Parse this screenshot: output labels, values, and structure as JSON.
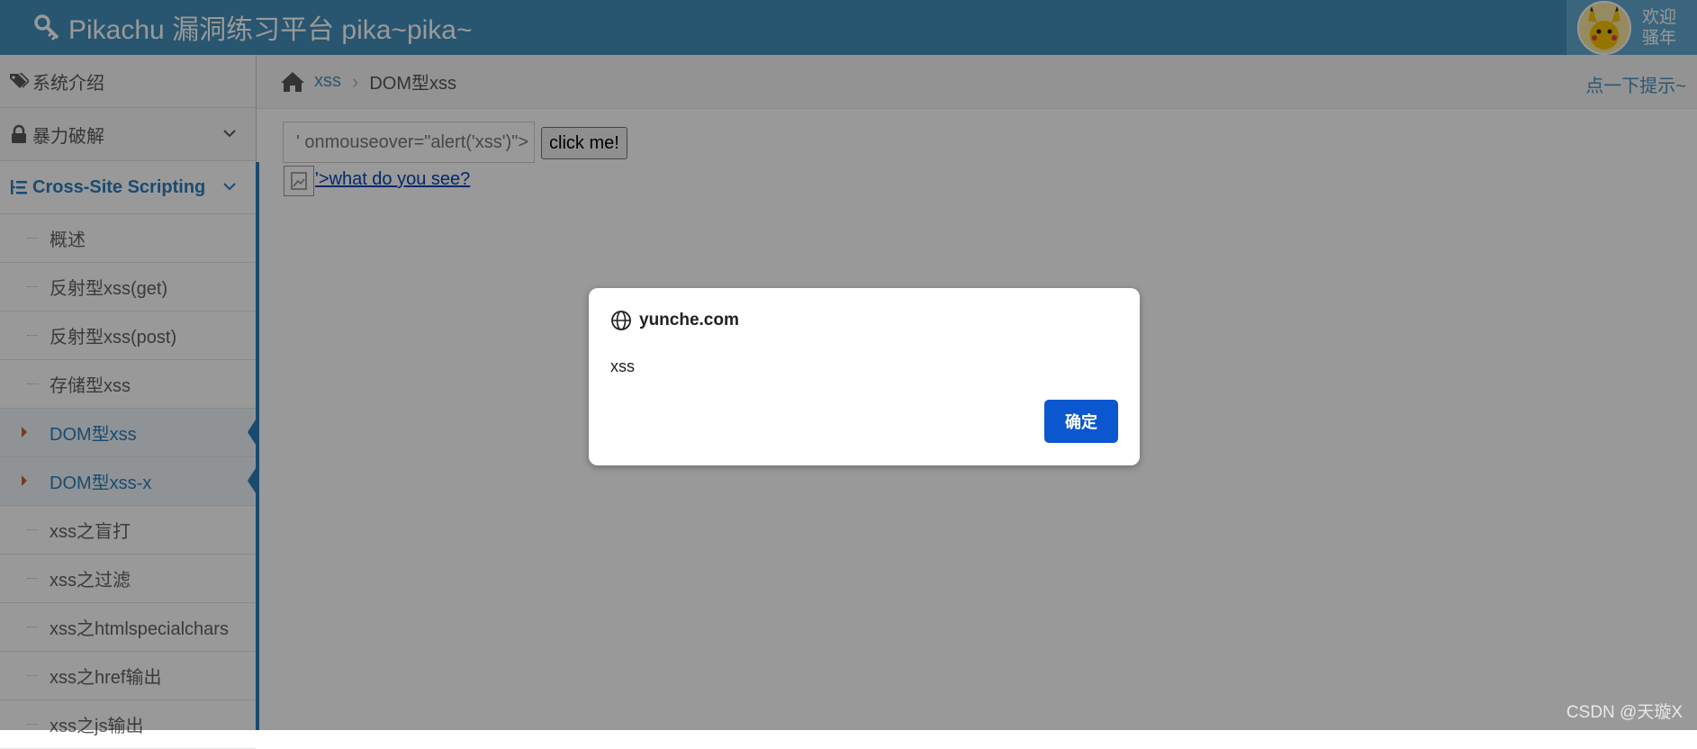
{
  "header": {
    "title": "Pikachu 漏洞练习平台 pika~pika~",
    "welcome_line1": "欢迎",
    "welcome_line2": "骚年"
  },
  "sidebar": {
    "items": [
      {
        "label": "系统介绍",
        "icon": "tags-icon"
      },
      {
        "label": "暴力破解",
        "icon": "lock-icon"
      },
      {
        "label": "Cross-Site Scripting",
        "icon": "list-icon"
      }
    ],
    "sub_items": [
      {
        "label": "概述"
      },
      {
        "label": "反射型xss(get)"
      },
      {
        "label": "反射型xss(post)"
      },
      {
        "label": "存储型xss"
      },
      {
        "label": "DOM型xss"
      },
      {
        "label": "DOM型xss-x"
      },
      {
        "label": "xss之盲打"
      },
      {
        "label": "xss之过滤"
      },
      {
        "label": "xss之htmlspecialchars"
      },
      {
        "label": "xss之href输出"
      },
      {
        "label": "xss之js输出"
      }
    ]
  },
  "breadcrumb": {
    "link": "xss",
    "separator": "›",
    "current": "DOM型xss",
    "hint": "点一下提示~"
  },
  "main": {
    "input_value": "' onmouseover=\"alert('xss')\">",
    "button_label": "click me!",
    "link_text": "'>what do you see?"
  },
  "dialog": {
    "origin": "yunche.com",
    "message": "xss",
    "ok_label": "确定"
  },
  "watermark": "CSDN @天璇X",
  "colors": {
    "header_bg": "#438eb9",
    "accent": "#2b7dbc",
    "dialog_button": "#0b57d0"
  }
}
